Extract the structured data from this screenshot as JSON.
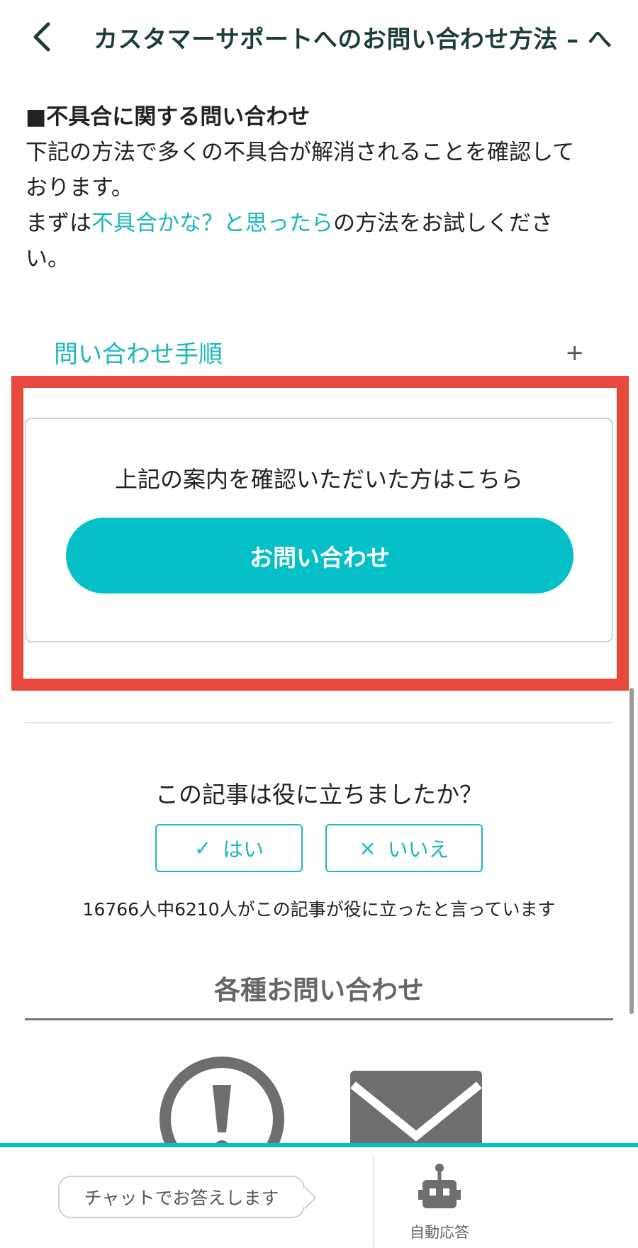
{
  "header": {
    "title": "カスタマーサポートへのお問い合わせ方法 – へ"
  },
  "intro": {
    "heading": "■不具合に関する問い合わせ",
    "line1": "下記の方法で多くの不具合が解消されることを確認して",
    "line2": "おります。",
    "line3_prefix": "まずは",
    "line3_link": "不具合かな？と思ったら",
    "line3_suffix": "の方法をお試しくださ",
    "line4": "い。"
  },
  "accordion": {
    "label": "問い合わせ手順",
    "toggle": "+"
  },
  "contact_card": {
    "text": "上記の案内を確認いただいた方はこちら",
    "button_label": "お問い合わせ"
  },
  "feedback": {
    "question": "この記事は役に立ちましたか？",
    "yes_icon": "✓",
    "yes_label": "はい",
    "no_icon": "×",
    "no_label": "いいえ",
    "stats": "16766人中6210人がこの記事が役に立ったと言っています"
  },
  "contact_section": {
    "title": "各種お問い合わせ",
    "icons": [
      "warning-icon",
      "mail-icon"
    ]
  },
  "bottom_bar": {
    "chat_bubble": "チャットでお答えします",
    "bot_label": "自動応答"
  },
  "colors": {
    "accent": "#06c0c8",
    "link": "#1cb8b8",
    "highlight": "#e8493c",
    "title": "#1c3d3a"
  }
}
